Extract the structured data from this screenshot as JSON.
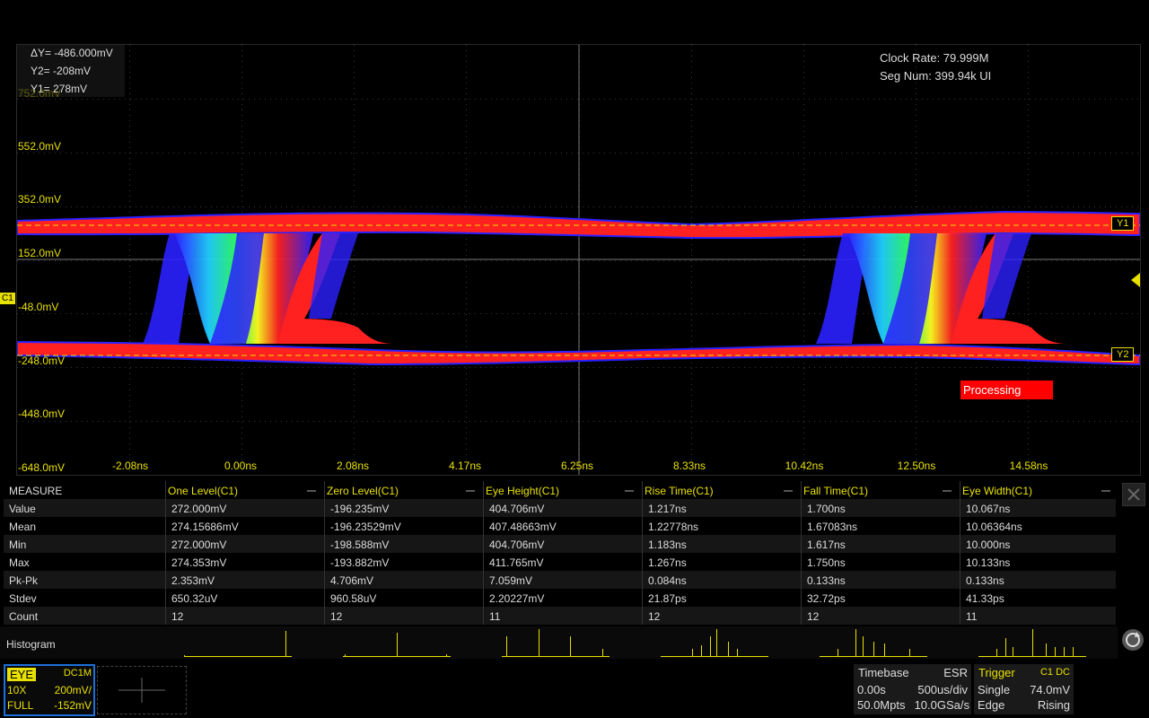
{
  "overlay": {
    "clock_rate": "Clock Rate: 79.999M",
    "seg_num": "Seg Num: 399.94k UI",
    "processing": "Processing"
  },
  "cursors": {
    "dy": "ΔY= -486.000mV",
    "y2": "Y2= -208mV",
    "y1": "Y1= 278mV",
    "y1_marker": "Y1",
    "y2_marker": "Y2"
  },
  "channel_marker": "C1",
  "y_axis_labels": [
    "552.0mV",
    "352.0mV",
    "152.0mV",
    "-48.0mV",
    "-248.0mV",
    "-448.0mV",
    "-648.0mV"
  ],
  "y_axis_top_partial": "752.0mV",
  "x_axis_labels": [
    "-2.08ns",
    "0.00ns",
    "2.08ns",
    "4.17ns",
    "6.25ns",
    "8.33ns",
    "10.42ns",
    "12.50ns",
    "14.58ns"
  ],
  "measure": {
    "header": [
      "MEASURE",
      "One Level(C1)",
      "Zero Level(C1)",
      "Eye Height(C1)",
      "Rise Time(C1)",
      "Fall Time(C1)",
      "Eye Width(C1)"
    ],
    "rows": [
      [
        "Value",
        "272.000mV",
        "-196.235mV",
        "404.706mV",
        "1.217ns",
        "1.700ns",
        "10.067ns"
      ],
      [
        "Mean",
        "274.15686mV",
        "-196.23529mV",
        "407.48663mV",
        "1.22778ns",
        "1.67083ns",
        "10.06364ns"
      ],
      [
        "Min",
        "272.000mV",
        "-198.588mV",
        "404.706mV",
        "1.183ns",
        "1.617ns",
        "10.000ns"
      ],
      [
        "Max",
        "274.353mV",
        "-193.882mV",
        "411.765mV",
        "1.267ns",
        "1.750ns",
        "10.133ns"
      ],
      [
        "Pk-Pk",
        "2.353mV",
        "4.706mV",
        "7.059mV",
        "0.084ns",
        "0.133ns",
        "0.133ns"
      ],
      [
        "Stdev",
        "650.32uV",
        "960.58uV",
        "2.20227mV",
        "21.87ps",
        "32.72ps",
        "41.33ps"
      ],
      [
        "Count",
        "12",
        "12",
        "11",
        "12",
        "12",
        "11"
      ]
    ],
    "histogram_label": "Histogram"
  },
  "channel_box": {
    "mode": "EYE",
    "coupling": "DC1M",
    "probe": "10X",
    "scale": "200mV/",
    "bw": "FULL",
    "offset": "-152mV"
  },
  "timebase": {
    "title": "Timebase",
    "mode": "ESR",
    "delay": "0.00s",
    "scale": "500us/div",
    "points": "50.0Mpts",
    "rate": "10.0GSa/s"
  },
  "trigger": {
    "title": "Trigger",
    "source": "C1 DC",
    "mode": "Single",
    "level": "74.0mV",
    "type": "Edge",
    "slope": "Rising"
  },
  "colors": {
    "accent": "#e8e000",
    "eye_hot": "#ff2020",
    "eye_cold": "#2a20ff",
    "channel_frame": "#1e6fd9"
  }
}
